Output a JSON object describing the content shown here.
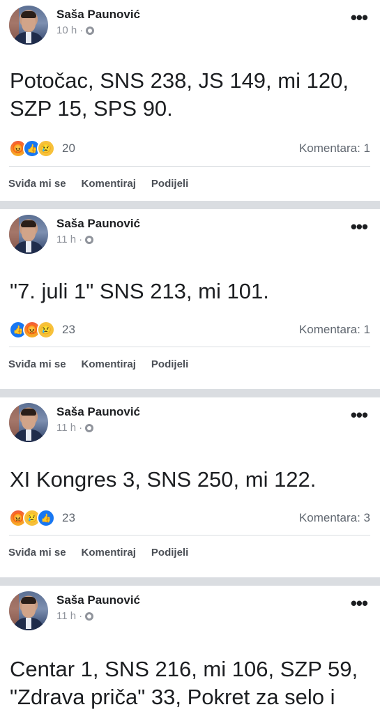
{
  "posts": [
    {
      "author": "Saša Paunović",
      "time": "10 h",
      "text": "Potočac, SNS 238, JS 149, mi 120, SZP 15, SPS 90.",
      "reactions": [
        "angry-icon",
        "like-icon",
        "sad-icon"
      ],
      "reaction_count": "20",
      "comments": "Komentara: 1"
    },
    {
      "author": "Saša Paunović",
      "time": "11 h",
      "text": "\"7. juli 1\" SNS 213, mi 101.",
      "reactions": [
        "like-icon",
        "angry-icon",
        "sad-icon"
      ],
      "reaction_count": "23",
      "comments": "Komentara: 1"
    },
    {
      "author": "Saša Paunović",
      "time": "11 h",
      "text": "XI Kongres 3, SNS 250, mi 122.",
      "reactions": [
        "angry-icon",
        "sad-icon",
        "like-icon"
      ],
      "reaction_count": "23",
      "comments": "Komentara: 3"
    },
    {
      "author": "Saša Paunović",
      "time": "11 h",
      "text": "Centar 1, SNS 216, mi 106, SZP 59, \"Zdrava priča\" 33, Pokret za selo i"
    }
  ],
  "actions": {
    "like": "Sviđa mi se",
    "comment": "Komentiraj",
    "share": "Podijeli"
  },
  "colors": {
    "like_blue": "#1877f2",
    "angry_red": "#f25a36",
    "sad_yellow": "#f7c13a",
    "separator": "#dadde1"
  }
}
